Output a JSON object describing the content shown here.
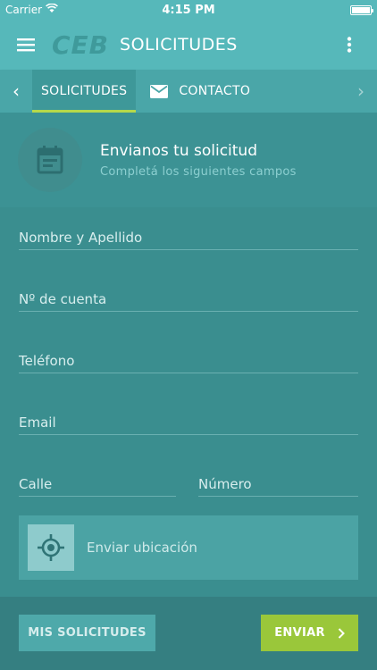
{
  "status_bar": {
    "carrier": "Carrier",
    "time": "4:15 PM"
  },
  "app_bar": {
    "logo": "CEB",
    "title": "SOLICITUDES"
  },
  "tabs": [
    {
      "label": "SOLICITUDES",
      "active": true
    },
    {
      "label": "CONTACTO",
      "active": false
    }
  ],
  "header": {
    "title": "Envianos tu solicitud",
    "subtitle": "Completá los siguientes campos"
  },
  "form": {
    "fields": [
      {
        "label": "Nombre y Apellido"
      },
      {
        "label": "Nº de cuenta"
      },
      {
        "label": "Teléfono"
      },
      {
        "label": "Email"
      },
      {
        "label": "Calle"
      },
      {
        "label": "Número"
      }
    ],
    "location_label": "Enviar ubicación"
  },
  "buttons": {
    "mis_solicitudes": "MIS SOLICITUDES",
    "enviar": "ENVIAR"
  },
  "colors": {
    "primary": "#56b8ba",
    "background": "#3a8e8f",
    "accent": "#9ac73a"
  }
}
